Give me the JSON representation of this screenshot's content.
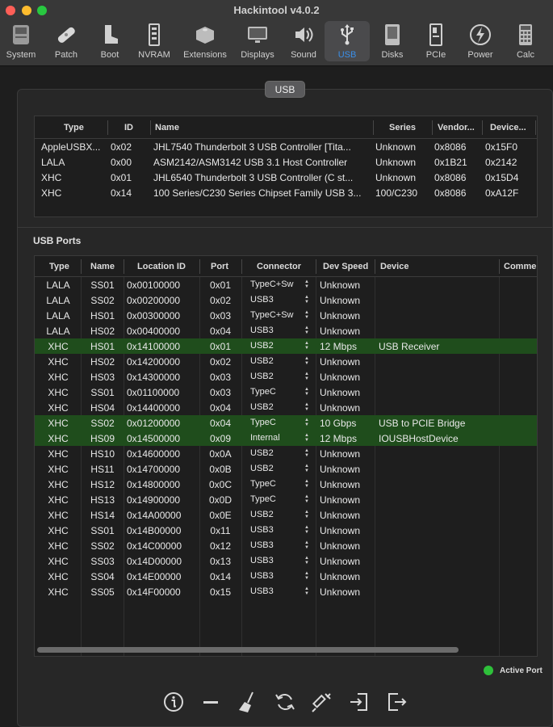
{
  "window": {
    "title": "Hackintool v4.0.2"
  },
  "toolbar": {
    "items": [
      {
        "label": "System",
        "icon": "system-icon"
      },
      {
        "label": "Patch",
        "icon": "bandage-icon"
      },
      {
        "label": "Boot",
        "icon": "boot-icon"
      },
      {
        "label": "NVRAM",
        "icon": "nvram-icon"
      },
      {
        "label": "Extensions",
        "icon": "lego-icon"
      },
      {
        "label": "Displays",
        "icon": "display-icon"
      },
      {
        "label": "Sound",
        "icon": "speaker-icon"
      },
      {
        "label": "USB",
        "icon": "usb-icon",
        "active": true
      },
      {
        "label": "Disks",
        "icon": "disk-icon"
      },
      {
        "label": "PCIe",
        "icon": "pcie-icon"
      },
      {
        "label": "Power",
        "icon": "power-icon"
      },
      {
        "label": "Calc",
        "icon": "calculator-icon"
      }
    ]
  },
  "segment": {
    "label": "USB"
  },
  "controllers": {
    "headers": [
      "Type",
      "ID",
      "Name",
      "Series",
      "Vendor...",
      "Device..."
    ],
    "rows": [
      [
        "AppleUSBX...",
        "0x02",
        "JHL7540 Thunderbolt 3 USB Controller [Tita...",
        "Unknown",
        "0x8086",
        "0x15F0"
      ],
      [
        "LALA",
        "0x00",
        "ASM2142/ASM3142 USB 3.1 Host Controller",
        "Unknown",
        "0x1B21",
        "0x2142"
      ],
      [
        "XHC",
        "0x01",
        "JHL6540 Thunderbolt 3 USB Controller (C st...",
        "Unknown",
        "0x8086",
        "0x15D4"
      ],
      [
        "XHC",
        "0x14",
        "100 Series/C230 Series Chipset Family USB 3...",
        "100/C230",
        "0x8086",
        "0xA12F"
      ]
    ]
  },
  "ports": {
    "title": "USB Ports",
    "headers": [
      "Type",
      "Name",
      "Location ID",
      "Port",
      "Connector",
      "Dev Speed",
      "Device",
      "Comme"
    ],
    "rows": [
      [
        "LALA",
        "SS01",
        "0x00100000",
        "0x01",
        "TypeC+Sw",
        "Unknown",
        "",
        false
      ],
      [
        "LALA",
        "SS02",
        "0x00200000",
        "0x02",
        "USB3",
        "Unknown",
        "",
        false
      ],
      [
        "LALA",
        "HS01",
        "0x00300000",
        "0x03",
        "TypeC+Sw",
        "Unknown",
        "",
        false
      ],
      [
        "LALA",
        "HS02",
        "0x00400000",
        "0x04",
        "USB3",
        "Unknown",
        "",
        false
      ],
      [
        "XHC",
        "HS01",
        "0x14100000",
        "0x01",
        "USB2",
        "12 Mbps",
        "USB Receiver",
        true
      ],
      [
        "XHC",
        "HS02",
        "0x14200000",
        "0x02",
        "USB2",
        "Unknown",
        "",
        false
      ],
      [
        "XHC",
        "HS03",
        "0x14300000",
        "0x03",
        "USB2",
        "Unknown",
        "",
        false
      ],
      [
        "XHC",
        "SS01",
        "0x01100000",
        "0x03",
        "TypeC",
        "Unknown",
        "",
        false
      ],
      [
        "XHC",
        "HS04",
        "0x14400000",
        "0x04",
        "USB2",
        "Unknown",
        "",
        false
      ],
      [
        "XHC",
        "SS02",
        "0x01200000",
        "0x04",
        "TypeC",
        "10 Gbps",
        "USB to PCIE Bridge",
        true
      ],
      [
        "XHC",
        "HS09",
        "0x14500000",
        "0x09",
        "Internal",
        "12 Mbps",
        "IOUSBHostDevice",
        true
      ],
      [
        "XHC",
        "HS10",
        "0x14600000",
        "0x0A",
        "USB2",
        "Unknown",
        "",
        false
      ],
      [
        "XHC",
        "HS11",
        "0x14700000",
        "0x0B",
        "USB2",
        "Unknown",
        "",
        false
      ],
      [
        "XHC",
        "HS12",
        "0x14800000",
        "0x0C",
        "TypeC",
        "Unknown",
        "",
        false
      ],
      [
        "XHC",
        "HS13",
        "0x14900000",
        "0x0D",
        "TypeC",
        "Unknown",
        "",
        false
      ],
      [
        "XHC",
        "HS14",
        "0x14A00000",
        "0x0E",
        "USB2",
        "Unknown",
        "",
        false
      ],
      [
        "XHC",
        "SS01",
        "0x14B00000",
        "0x11",
        "USB3",
        "Unknown",
        "",
        false
      ],
      [
        "XHC",
        "SS02",
        "0x14C00000",
        "0x12",
        "USB3",
        "Unknown",
        "",
        false
      ],
      [
        "XHC",
        "SS03",
        "0x14D00000",
        "0x13",
        "USB3",
        "Unknown",
        "",
        false
      ],
      [
        "XHC",
        "SS04",
        "0x14E00000",
        "0x14",
        "USB3",
        "Unknown",
        "",
        false
      ],
      [
        "XHC",
        "SS05",
        "0x14F00000",
        "0x15",
        "USB3",
        "Unknown",
        "",
        false
      ]
    ]
  },
  "legend": {
    "label": "Active Port",
    "color": "#2ec03a"
  },
  "actions": [
    {
      "icon": "info-icon"
    },
    {
      "icon": "minus-icon"
    },
    {
      "icon": "broom-icon"
    },
    {
      "icon": "refresh-icon"
    },
    {
      "icon": "syringe-icon"
    },
    {
      "icon": "import-icon"
    },
    {
      "icon": "export-icon"
    }
  ]
}
